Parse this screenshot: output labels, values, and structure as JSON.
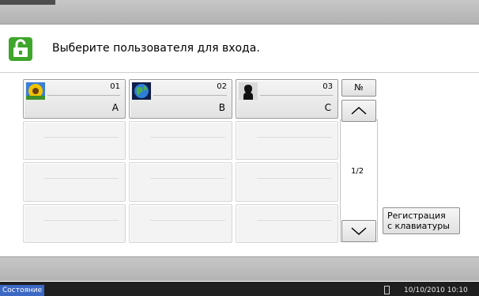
{
  "header": {
    "title": "Выберите пользователя для входа."
  },
  "users": [
    {
      "number": "01",
      "name": "A",
      "avatar": "sunflower-avatar"
    },
    {
      "number": "02",
      "name": "B",
      "avatar": "globe-avatar"
    },
    {
      "number": "03",
      "name": "C",
      "avatar": "silhouette-avatar"
    }
  ],
  "sidepanel": {
    "sort_label": "№",
    "page_indicator": "1/2"
  },
  "keyboard_login_label_1": "Регистрация",
  "keyboard_login_label_2": "с клавиатуры",
  "statusbar": {
    "status_label": "Состояние",
    "datetime": "10/10/2010  10:10"
  },
  "colors": {
    "accent_green": "#3ea62b",
    "status_blue": "#3c68c4"
  }
}
